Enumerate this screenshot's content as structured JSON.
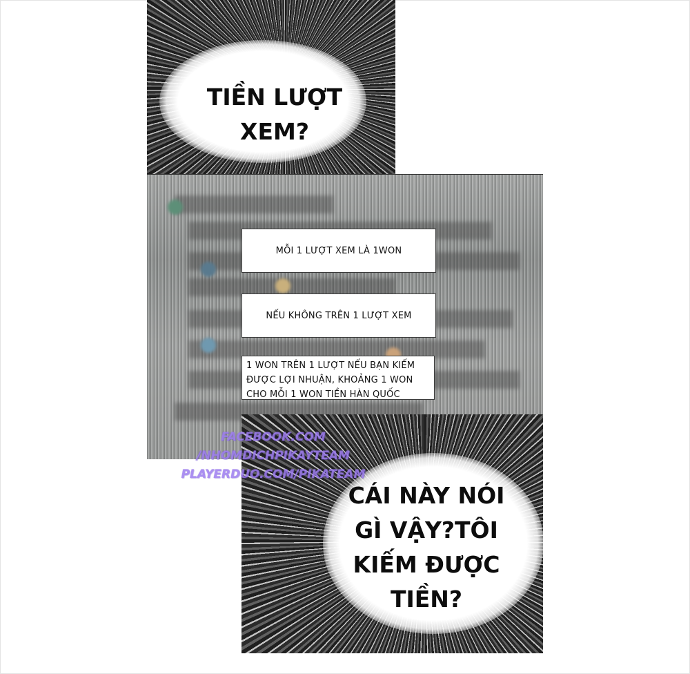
{
  "panels": {
    "top": {
      "shout": "TIỀN LƯỢT\nXEM?"
    },
    "screen": {
      "box1": "MỖI 1 LƯỢT XEM LÀ 1WON",
      "box2": "NẾU KHÔNG TRÊN 1 LƯỢT XEM",
      "box3_lines": [
        "1 WON TRÊN 1 LƯỢT NẾU BẠN KIẾM",
        "ĐƯỢC LỢI NHUẬN, KHOẢNG 1 WON",
        "CHO MỖI 1 WON TIỀN HÀN QUỐC"
      ]
    },
    "bottom": {
      "shout": "CÁI NÀY NÓI\nGÌ VẬY?TÔI\nKIẾM ĐƯỢC\nTIỀN?"
    }
  },
  "watermark": {
    "lines": [
      "FACEBOOK.COM",
      "/NHOMDICHPIKAYTEAM",
      "PLAYERDUO.COM/PIKATEAM"
    ],
    "color": "#9d7cf0"
  }
}
